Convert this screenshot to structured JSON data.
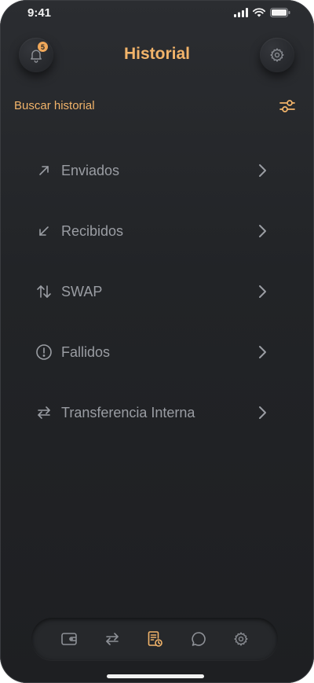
{
  "status_bar": {
    "time": "9:41"
  },
  "header": {
    "title": "Historial",
    "notification_count": "5"
  },
  "search": {
    "label": "Buscar historial"
  },
  "menu": {
    "items": [
      {
        "label": "Enviados",
        "icon": "arrow-up-right-icon"
      },
      {
        "label": "Recibidos",
        "icon": "arrow-down-left-icon"
      },
      {
        "label": "SWAP",
        "icon": "swap-vertical-icon"
      },
      {
        "label": "Fallidos",
        "icon": "alert-circle-icon"
      },
      {
        "label": "Transferencia Interna",
        "icon": "transfer-arrows-icon"
      }
    ]
  },
  "bottom_nav": {
    "items": [
      {
        "icon": "wallet-icon",
        "active": false
      },
      {
        "icon": "transfer-arrows-icon",
        "active": false
      },
      {
        "icon": "history-icon",
        "active": true
      },
      {
        "icon": "chat-icon",
        "active": false
      },
      {
        "icon": "gear-icon",
        "active": false
      }
    ]
  },
  "colors": {
    "accent": "#f2b46a",
    "text_muted": "#9a9da3",
    "background": "#222427",
    "icon_inactive": "#8e9197"
  }
}
